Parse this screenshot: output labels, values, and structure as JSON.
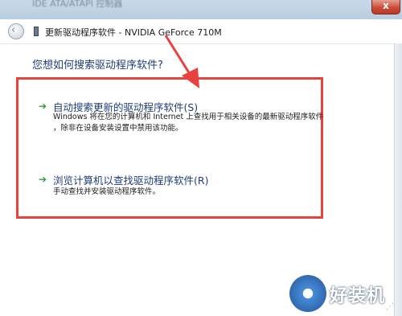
{
  "window": {
    "blurred_title": "IDE ATA/ATAPI 控制器",
    "close_label": "x"
  },
  "nav": {
    "title": "更新驱动程序软件 - NVIDIA GeForce 710M",
    "back_symbol": "‹"
  },
  "question": "您想如何搜索驱动程序软件?",
  "options": [
    {
      "title": "自动搜索更新的驱动程序软件(S)",
      "desc_lines": [
        "Windows 将在您的计算机和 Internet 上查找用于相关设备的最新驱动程序软件",
        "，除非在设备安装设置中禁用该功能。"
      ]
    },
    {
      "title": "浏览计算机以查找驱动程序软件(R)",
      "desc_lines": [
        "手动查找并安装驱动程序软件。"
      ]
    }
  ],
  "arrow_glyph": "➔",
  "watermark": {
    "text": "好装机"
  },
  "colors": {
    "highlight": "#e8413e",
    "link": "#1f3d7a",
    "arrow": "#2e9a3a"
  }
}
